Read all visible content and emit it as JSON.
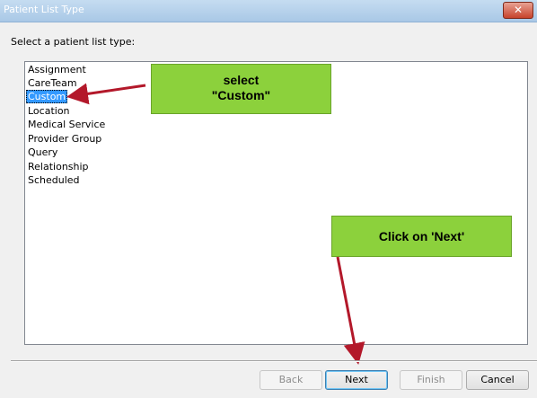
{
  "window": {
    "title": "Patient List Type",
    "close_label": "✕"
  },
  "prompt": "Select a patient list type:",
  "list": {
    "items": [
      "Assignment",
      "CareTeam",
      "Custom",
      "Location",
      "Medical Service",
      "Provider Group",
      "Query",
      "Relationship",
      "Scheduled"
    ],
    "selected": "Custom"
  },
  "callouts": {
    "custom_line1": "select",
    "custom_line2": "\"Custom\"",
    "next": "Click on 'Next'"
  },
  "buttons": {
    "back": "Back",
    "next": "Next",
    "finish": "Finish",
    "cancel": "Cancel"
  },
  "colors": {
    "callout_green": "#8cd13c",
    "arrow_red": "#b3182a",
    "selection_blue": "#3399ff"
  }
}
